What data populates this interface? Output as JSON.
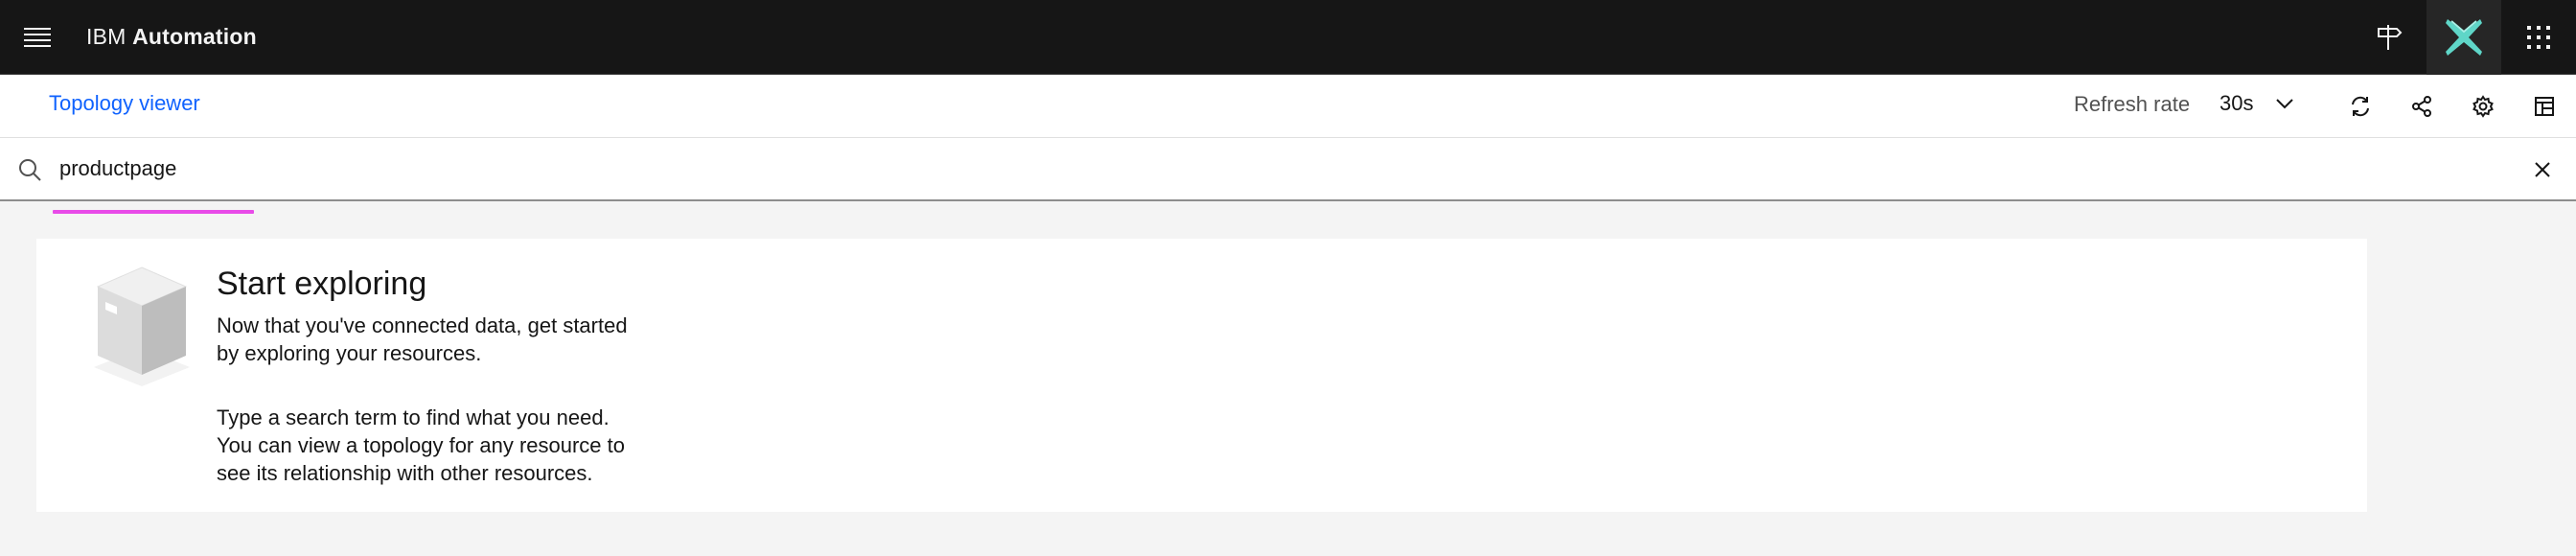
{
  "header": {
    "brand_prefix": "IBM",
    "brand_name": "Automation",
    "icons": {
      "menu": "hamburger-menu-icon",
      "guide": "signpost-icon",
      "assistant": "ai-assistant-x-icon",
      "apps": "app-switcher-grid-icon"
    }
  },
  "subheader": {
    "page_title": "Topology viewer",
    "refresh_label": "Refresh rate",
    "refresh_value": "30s",
    "icons": [
      "refresh-icon",
      "share-icon",
      "settings-icon",
      "layout-icon"
    ]
  },
  "search": {
    "value": "productpage",
    "placeholder": ""
  },
  "empty_state": {
    "title": "Start exploring",
    "paragraph1_line1": "Now that you've connected data, get started",
    "paragraph1_line2": "by exploring your resources.",
    "paragraph2_line1": "Type a search term to find what you need.",
    "paragraph2_line2": "You can view a topology for any resource to",
    "paragraph2_line3": "see its relationship with other resources."
  },
  "colors": {
    "header_bg": "#161616",
    "link": "#0f62fe",
    "accent_underline": "#e84be8",
    "page_bg": "#f4f4f4"
  }
}
